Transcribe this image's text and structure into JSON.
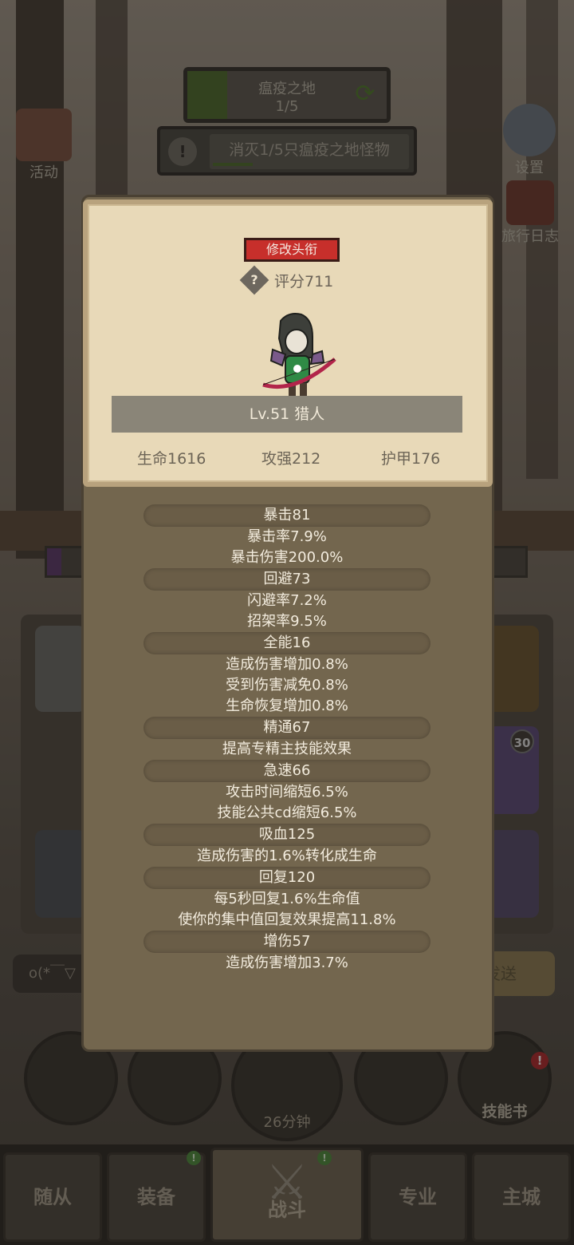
{
  "zone": {
    "name": "瘟疫之地",
    "progress": "1/5",
    "progress_fraction": 0.2
  },
  "quest": {
    "text": "消灭1/5只瘟疫之地怪物",
    "progress_fraction": 0.2
  },
  "side_buttons": {
    "event": "活动",
    "settings": "设置",
    "journal": "旅行日志"
  },
  "character": {
    "rename_label": "修改头衔",
    "score": "评分711",
    "name_level": "Lv.51 猎人",
    "stats": {
      "hp": "生命1616",
      "attack": "攻强212",
      "armor": "护甲176"
    }
  },
  "attributes": [
    {
      "title": "暴击81",
      "lines": [
        "暴击率7.9%",
        "暴击伤害200.0%"
      ]
    },
    {
      "title": "回避73",
      "lines": [
        "闪避率7.2%",
        "招架率9.5%"
      ]
    },
    {
      "title": "全能16",
      "lines": [
        "造成伤害增加0.8%",
        "受到伤害减免0.8%",
        "生命恢复增加0.8%"
      ]
    },
    {
      "title": "精通67",
      "lines": [
        "提高专精主技能效果"
      ]
    },
    {
      "title": "急速66",
      "lines": [
        "攻击时间缩短6.5%",
        "技能公共cd缩短6.5%"
      ]
    },
    {
      "title": "吸血125",
      "lines": [
        "造成伤害的1.6%转化成生命"
      ]
    },
    {
      "title": "回复120",
      "lines": [
        "每5秒回复1.6%生命值",
        "使你的集中值回复效果提高11.8%"
      ]
    },
    {
      "title": "增伤57",
      "lines": [
        "造成伤害增加3.7%"
      ]
    }
  ],
  "background": {
    "chat_placeholder": "o(*￣▽",
    "send_label": "发送",
    "timer": "26分钟",
    "skill_book": "技能书",
    "level_badge": "30",
    "notice_badge": "!"
  },
  "tabs": [
    "随从",
    "装备",
    "战斗",
    "专业",
    "主城"
  ],
  "colors": {
    "rename_button": "#c72f2b",
    "card_bg": "#e8d9b8",
    "popup_bg": "#73664e"
  }
}
